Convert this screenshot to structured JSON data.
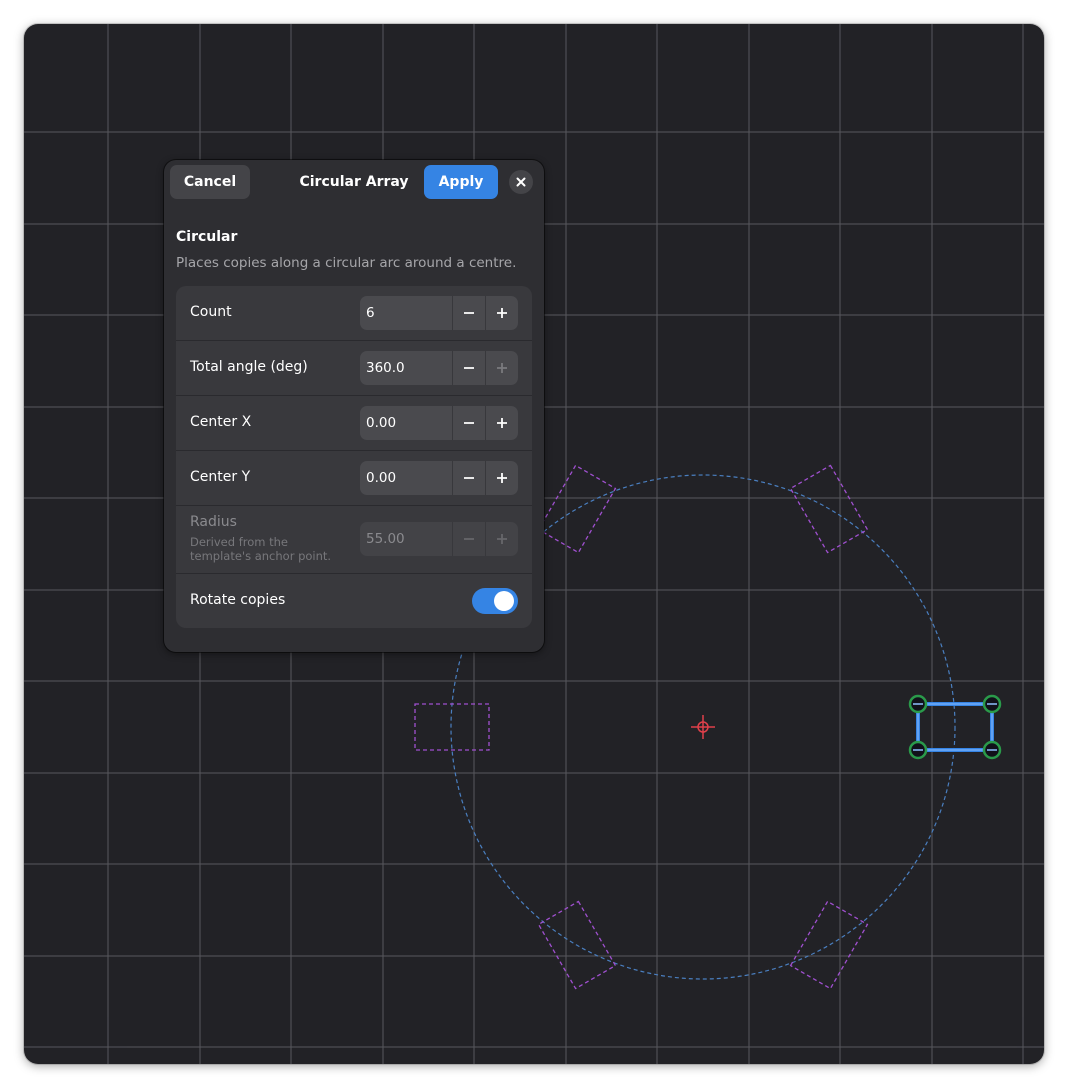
{
  "dialog": {
    "title": "Circular Array",
    "cancel_label": "Cancel",
    "apply_label": "Apply",
    "close_icon": "close-icon"
  },
  "section": {
    "title": "Circular",
    "description": "Places copies along a circular arc around a centre."
  },
  "rows": {
    "count": {
      "label": "Count",
      "value": "6"
    },
    "total_angle": {
      "label": "Total angle (deg)",
      "value": "360.0"
    },
    "center_x": {
      "label": "Center X",
      "value": "0.00"
    },
    "center_y": {
      "label": "Center Y",
      "value": "0.00"
    },
    "radius": {
      "label": "Radius",
      "sublabel": "Derived from the template's anchor point.",
      "value": "55.00"
    },
    "rotate": {
      "label": "Rotate copies",
      "checked": true
    }
  },
  "icons": {
    "minus": "minus-icon",
    "plus": "plus-icon"
  },
  "colors": {
    "canvas_bg": "#222226",
    "grid_line": "#6a6a70",
    "accent": "#3584e4",
    "preview_copy": "#a050d0",
    "guide_circle": "#4a7fc0",
    "center_marker": "#e0404a",
    "handle": "#2a9a4a"
  }
}
